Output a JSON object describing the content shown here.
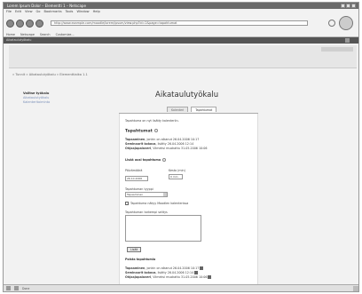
{
  "window": {
    "title": "Lorem Ipsum Dolor – Elementti 1 – Netscape",
    "url": "http://www.example.com/moodle/lorem/ipsum/view.php?id=2&page=tapahtumat"
  },
  "menu": [
    "File",
    "Edit",
    "View",
    "Go",
    "Bookmarks",
    "Tools",
    "Window",
    "Help"
  ],
  "bookmarks": [
    "Home",
    "Netscape",
    "Search",
    "Customize..."
  ],
  "tab_title": "Aikataulutyökalu",
  "breadcrumb": "» Tunnit » Aikataulutyökalu » Elementtiaika 1.1",
  "sidebar": {
    "heading": "Valitse työkalu",
    "links": [
      "Aikataulutyökalu",
      "Kalenteritoiminto"
    ]
  },
  "app_title": "Aikataulutyökalu",
  "tabs": [
    "Kalenteri",
    "Tapahtumat"
  ],
  "content": {
    "intro": "Tapahtuma on nyt lisätty kalenteriin.",
    "events_heading": "Tapahtumat",
    "events": [
      {
        "label": "Tapaaminen",
        "text": ", jonkin on alkanut 26.04.2006 10:17"
      },
      {
        "label": "Seminaarit kokous",
        "text": ", lisätty 26.04.2006 12:14"
      },
      {
        "label": "Ohjaajapalaveri",
        "text": ", Viimeksi muokattu 31.05.2006 10:06"
      }
    ],
    "form_heading": "Lisää uusi tapahtuma",
    "date_label": "Päivämäärä",
    "date_value": "26.10.2006",
    "duration_label": "Kesto (min)",
    "duration_value": "0 min",
    "type_label": "Tapahtuman tyyppi",
    "type_value": "Tapaaminen",
    "checkbox_label": "Tapahtuma näkyy Moodlen kalenterissa",
    "desc_label": "Tapahtuman tarkempi selitys",
    "submit_label": "Lisää",
    "past_heading": "Poista tapahtumia",
    "past_events": [
      {
        "label": "Tapaaminen",
        "text": ", jonkin on alkanut 26.04.2006 10:17"
      },
      {
        "label": "Seminaarit kokous",
        "text": ", lisätty 26.04.2006 12:14"
      },
      {
        "label": "Ohjaajapalaveri",
        "text": ", Viimeksi muokattu 31.05.2006 10:06"
      }
    ]
  },
  "status": "Done"
}
